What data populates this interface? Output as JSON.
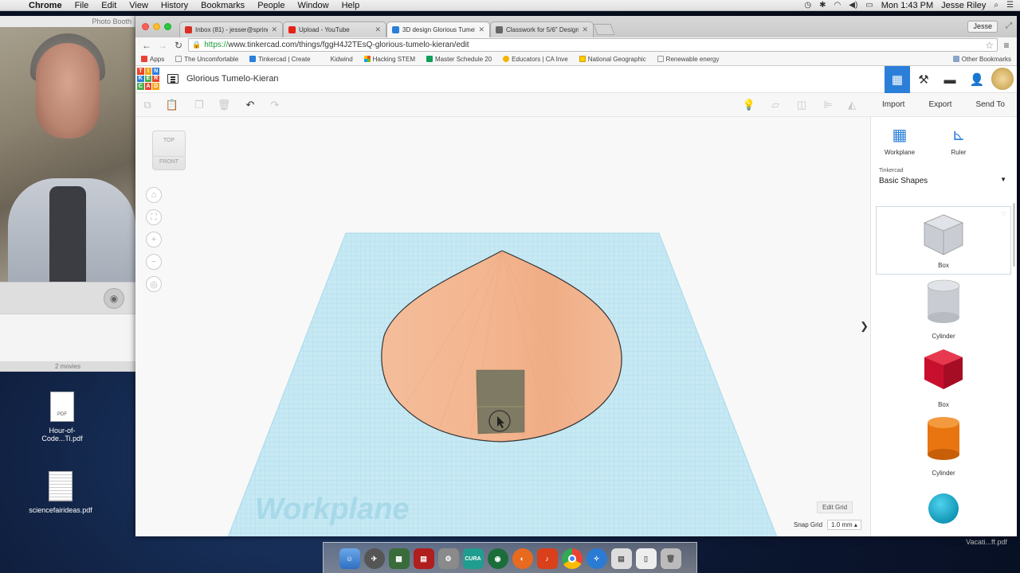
{
  "menubar": {
    "app": "Chrome",
    "items": [
      "File",
      "Edit",
      "View",
      "History",
      "Bookmarks",
      "People",
      "Window",
      "Help"
    ],
    "clock": "Mon 1:43 PM",
    "user": "Jesse Riley"
  },
  "photobooth": {
    "title": "Photo Booth",
    "count": "2 movies"
  },
  "desktop": {
    "icons": [
      {
        "label": "Hour-of-Code...Ti.pdf"
      },
      {
        "label": "sciencefairideas.pdf"
      },
      {
        "label": "Vacati...ff.pdf"
      }
    ]
  },
  "browser": {
    "tabs": [
      {
        "title": "Inbox (81) - jesser@spring",
        "color": "#d93025"
      },
      {
        "title": "Upload - YouTube",
        "color": "#e62117"
      },
      {
        "title": "3D design Glorious Tumelo",
        "color": "#2b7fd9"
      },
      {
        "title": "Classwork for 5/6\" Design",
        "color": "#666666"
      }
    ],
    "profile": "Jesse",
    "url_scheme": "https://",
    "url_rest": "www.tinkercad.com/things/fggH4J2TEsQ-glorious-tumelo-kieran/edit",
    "bookmarks": [
      {
        "label": "Apps",
        "color": "#e94235"
      },
      {
        "label": "The Uncomfortable",
        "color": "#999999"
      },
      {
        "label": "Tinkercad | Create",
        "color": "#2b7fd9"
      },
      {
        "label": "Kidwind",
        "color": "#ffffff"
      },
      {
        "label": "Hacking STEM",
        "color": "#f25022"
      },
      {
        "label": "Master Schedule 20",
        "color": "#0f9d58"
      },
      {
        "label": "Educators | CA Inve",
        "color": "#f4b400"
      },
      {
        "label": "National Geographic",
        "color": "#ffcc00"
      },
      {
        "label": "Renewable energy",
        "color": "#999999"
      }
    ],
    "other_bookmarks": "Other Bookmarks"
  },
  "tinkercad": {
    "logo_letters": [
      "T",
      "I",
      "N",
      "K",
      "E",
      "R",
      "C",
      "A",
      "D"
    ],
    "design_name": "Glorious Tumelo-Kieran",
    "actions": [
      "Import",
      "Export",
      "Send To"
    ],
    "viewcube": {
      "top": "TOP",
      "front": "FRONT"
    },
    "workplane_text": "Workplane",
    "edit_grid": "Edit Grid",
    "snap_grid_label": "Snap Grid",
    "snap_grid_value": "1.0 mm",
    "panel": {
      "workplane_label": "Workplane",
      "ruler_label": "Ruler",
      "library_small": "Tinkercad",
      "library_name": "Basic Shapes",
      "shapes": [
        {
          "label": "Box",
          "style": "hole-box"
        },
        {
          "label": "Cylinder",
          "style": "hole-cylinder"
        },
        {
          "label": "Box",
          "style": "red-box"
        },
        {
          "label": "Cylinder",
          "style": "orange-cylinder"
        },
        {
          "label": "",
          "style": "teal-sphere"
        }
      ]
    },
    "colors": {
      "accent": "#2b7fd9",
      "cone": "#f0b28e",
      "workplane": "#bfe6f2",
      "hole": "#7f7a63"
    }
  }
}
